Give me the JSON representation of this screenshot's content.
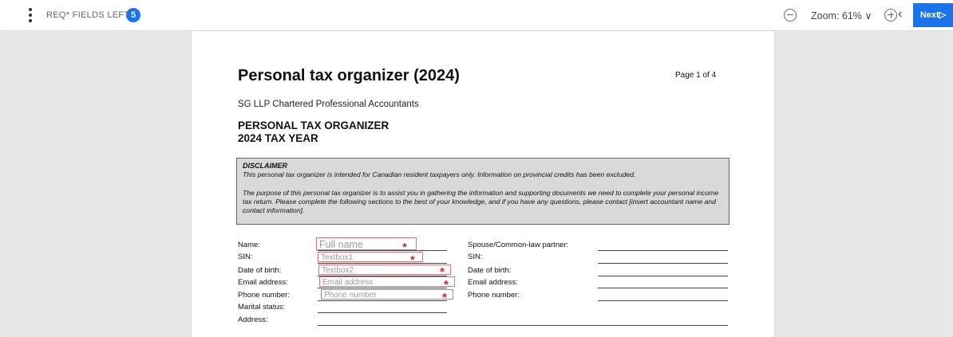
{
  "toolbar": {
    "required_label": "REQ* FIELDS LEFT",
    "required_count": "5",
    "zoom_label": "Zoom: 61% ∨",
    "prev_glyph": "‹",
    "next_label": "Next▷"
  },
  "document": {
    "title": "Personal tax organizer (2024)",
    "page_indicator": "Page 1 of 4",
    "firm": "SG LLP Chartered Professional Accountants",
    "heading_1": "PERSONAL TAX ORGANIZER",
    "heading_2": "2024 TAX YEAR",
    "disclaimer": {
      "title": "DISCLAIMER",
      "paragraph_1": "This personal tax organizer is intended for Canadian resident taxpayers only. Information on provincial credits has been excluded.",
      "paragraph_2": "The purpose of this personal tax organizer is to assist you in gathering the information and supporting documents we need to complete your personal income tax return. Please complete the following sections to the best of your knowledge, and if you have any questions, please contact [insert accountant name and contact information]."
    },
    "taxpayer_labels": {
      "name": "Name:",
      "sin": "SIN:",
      "dob": "Date of birth:",
      "email": "Email address:",
      "phone": "Phone number:",
      "marital": "Marital status:",
      "address": "Address:"
    },
    "fields": {
      "name_placeholder": "Full name",
      "sin_placeholder": "Textbox1",
      "dob_placeholder": "Textbox2",
      "email_placeholder": "Email address",
      "phone_placeholder": "Phone number",
      "required_mark": "*"
    },
    "spouse_labels": {
      "spouse": "Spouse/Common-law partner:",
      "sin": "SIN:",
      "dob": "Date of birth:",
      "email": "Email address:",
      "phone": "Phone number:"
    }
  },
  "colors": {
    "accent": "#1a73e8",
    "required_star": "#cc2a2a",
    "disclaimer_bg": "#d9d9d9"
  }
}
